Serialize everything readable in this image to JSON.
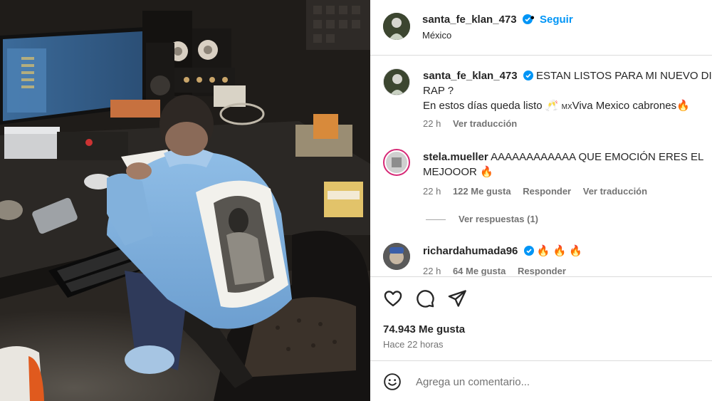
{
  "post": {
    "username": "santa_fe_klan_473",
    "follow_label": "Seguir",
    "separator": "•",
    "location": "México"
  },
  "caption": {
    "username": "santa_fe_klan_473",
    "line1": "ESTAN LISTOS PARA MI NUEVO DISCO",
    "line2": "RAP ?",
    "line3": "En estos días queda listo 🥂 ",
    "line3_flag": "MX",
    "line3_tail": "Viva Mexico cabrones",
    "line3_emoji": "🔥",
    "time": "22 h",
    "translate": "Ver traducción"
  },
  "comments": [
    {
      "username": "stela.mueller",
      "text_line1": "AAAAAAAAAAAA QUE EMOCIÓN ERES EL",
      "text_line2": "MEJOOOR",
      "emoji": "🔥",
      "time": "22 h",
      "likes": "122 Me gusta",
      "reply": "Responder",
      "translate": "Ver traducción",
      "view_replies": "Ver respuestas (1)"
    },
    {
      "username": "richardahumada96",
      "emojis": "🔥 🔥 🔥",
      "time": "22 h",
      "likes": "64 Me gusta",
      "reply": "Responder"
    }
  ],
  "actions": {
    "like_icon": "heart-icon",
    "comment_icon": "comment-icon",
    "share_icon": "share-icon",
    "likes_count": "74.943 Me gusta",
    "time_ago": "Hace 22 horas"
  },
  "add_comment": {
    "placeholder": "Agrega un comentario..."
  },
  "colors": {
    "link_blue": "#0095f6",
    "verified_blue": "#0095f6",
    "muted": "#737373",
    "border": "#dbdbdb"
  }
}
